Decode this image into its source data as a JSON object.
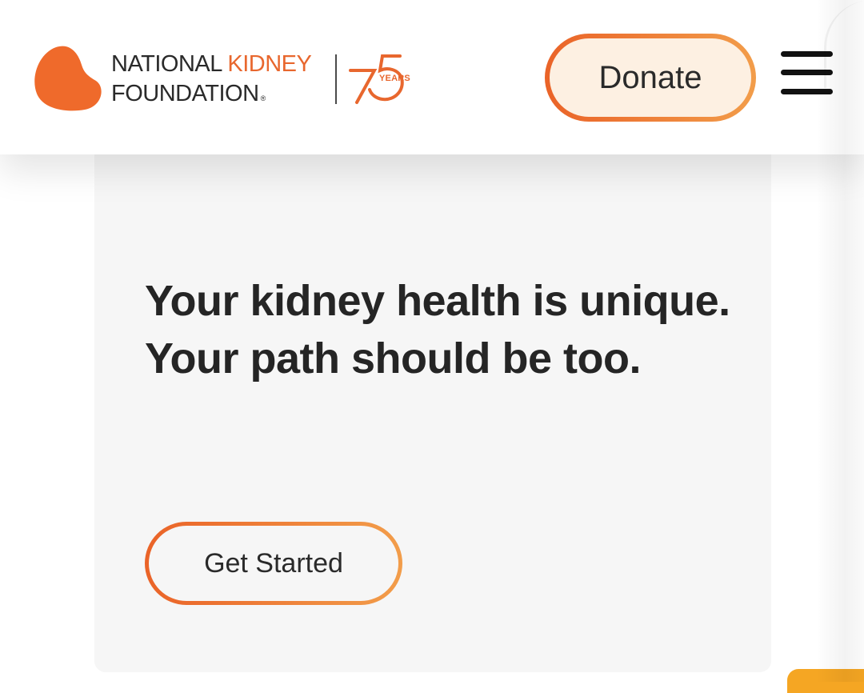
{
  "header": {
    "logo": {
      "line1_part1": "NATIONAL",
      "line1_part2": "KIDNEY",
      "line2": "FOUNDATION",
      "registered": "®",
      "anniversary_number": "75",
      "anniversary_word": "YEARS"
    },
    "donate_label": "Donate",
    "menu_icon": "hamburger-menu-icon"
  },
  "hero": {
    "headline": "Your kidney health is unique. Your path should be too.",
    "cta_label": "Get Started"
  },
  "colors": {
    "brand_orange": "#e8672e",
    "gradient_start": "#ea6328",
    "gradient_end": "#f29d4a",
    "donate_fill": "#fdf0e2",
    "card_bg": "#f6f6f6",
    "text": "#252525"
  }
}
